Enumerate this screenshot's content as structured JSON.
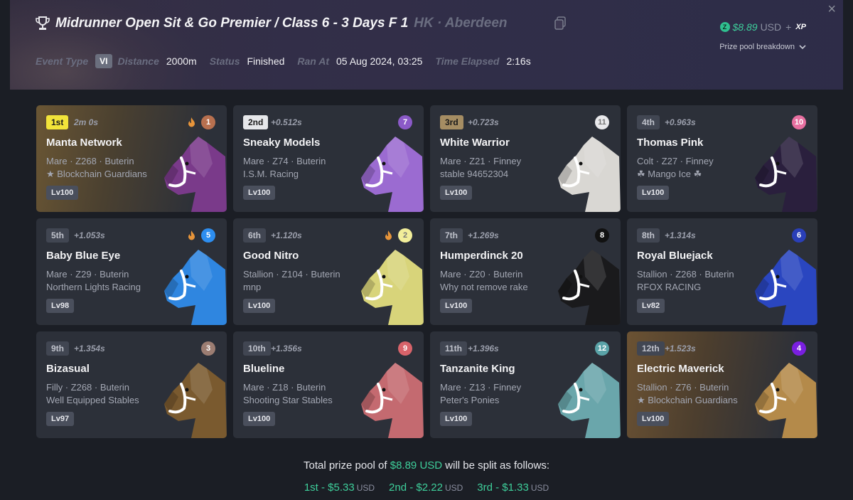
{
  "header": {
    "title": "Midrunner Open Sit & Go Premier / Class 6 - 3 Days F 1",
    "location": "HK · Aberdeen",
    "event_type_label": "Event Type",
    "event_type_badge": "VI",
    "distance_label": "Distance",
    "distance_value": "2000m",
    "status_label": "Status",
    "status_value": "Finished",
    "ran_at_label": "Ran At",
    "ran_at_value": "05 Aug 2024, 03:25",
    "elapsed_label": "Time Elapsed",
    "elapsed_value": "2:16s",
    "prize_amount": "$8.89",
    "prize_currency": "USD",
    "prize_plus": "+",
    "prize_xp": "XP",
    "breakdown_label": "Prize pool breakdown",
    "close_glyph": "×",
    "z_glyph": "Z"
  },
  "horses": [
    {
      "place": "1st",
      "gap": "2m 0s",
      "gate": "1",
      "gate_color": "#b8704f",
      "flame": true,
      "name": "Manta Network",
      "line1": "Mare · Z268 · Buterin",
      "line2": "★ Blockchain Guardians",
      "level": "Lv100",
      "coat": "#7a3a8a",
      "card": "gold"
    },
    {
      "place": "2nd",
      "gap": "+0.512s",
      "gate": "7",
      "gate_color": "#8b5ac8",
      "flame": false,
      "name": "Sneaky Models",
      "line1": "Mare · Z74 · Buterin",
      "line2": "I.S.M. Racing",
      "level": "Lv100",
      "coat": "#9b6bd1",
      "card": ""
    },
    {
      "place": "3rd",
      "gap": "+0.723s",
      "gate": "11",
      "gate_color": "#e9e9ec",
      "flame": false,
      "name": "White Warrior",
      "line1": "Mare · Z21 · Finney",
      "line2": "stable 94652304",
      "level": "Lv100",
      "coat": "#d9d7d3",
      "card": ""
    },
    {
      "place": "4th",
      "gap": "+0.963s",
      "gate": "10",
      "gate_color": "#e76fa0",
      "flame": false,
      "name": "Thomas Pink",
      "line1": "Colt · Z27 · Finney",
      "line2": "☘ Mango Ice ☘",
      "level": "Lv100",
      "coat": "#2a1f3d",
      "card": ""
    },
    {
      "place": "5th",
      "gap": "+1.053s",
      "gate": "5",
      "gate_color": "#2d8ef0",
      "flame": true,
      "name": "Baby Blue Eye",
      "line1": "Mare · Z29 · Buterin",
      "line2": "Northern Lights Racing",
      "level": "Lv98",
      "coat": "#2f86e0",
      "card": ""
    },
    {
      "place": "6th",
      "gap": "+1.120s",
      "gate": "2",
      "gate_color": "#f2ee9a",
      "flame": true,
      "name": "Good Nitro",
      "line1": "Stallion · Z104 · Buterin",
      "line2": "mnp",
      "level": "Lv100",
      "coat": "#d8d47a",
      "card": ""
    },
    {
      "place": "7th",
      "gap": "+1.269s",
      "gate": "8",
      "gate_color": "#111111",
      "flame": false,
      "name": "Humperdinck 20",
      "line1": "Mare · Z20 · Buterin",
      "line2": "Why not remove rake",
      "level": "Lv100",
      "coat": "#1a1a1c",
      "card": ""
    },
    {
      "place": "8th",
      "gap": "+1.314s",
      "gate": "6",
      "gate_color": "#2a3fb8",
      "flame": false,
      "name": "Royal Bluejack",
      "line1": "Stallion · Z268 · Buterin",
      "line2": "RFOX RACING",
      "level": "Lv82",
      "coat": "#2a46c0",
      "card": ""
    },
    {
      "place": "9th",
      "gap": "+1.354s",
      "gate": "3",
      "gate_color": "#9c7d72",
      "flame": false,
      "name": "Bizasual",
      "line1": "Filly · Z268 · Buterin",
      "line2": "Well Equipped Stables",
      "level": "Lv97",
      "coat": "#7a5a2f",
      "card": ""
    },
    {
      "place": "10th",
      "gap": "+1.356s",
      "gate": "9",
      "gate_color": "#d8636a",
      "flame": false,
      "name": "Blueline",
      "line1": "Mare · Z18 · Buterin",
      "line2": "Shooting Star Stables",
      "level": "Lv100",
      "coat": "#c46a70",
      "card": ""
    },
    {
      "place": "11th",
      "gap": "+1.396s",
      "gate": "12",
      "gate_color": "#5aa3a8",
      "flame": false,
      "name": "Tanzanite King",
      "line1": "Mare · Z13 · Finney",
      "line2": "Peter's Ponies",
      "level": "Lv100",
      "coat": "#6aa6ab",
      "card": ""
    },
    {
      "place": "12th",
      "gap": "+1.523s",
      "gate": "4",
      "gate_color": "#7a1fe0",
      "flame": false,
      "name": "Electric Maverick",
      "line1": "Stallion · Z76 · Buterin",
      "line2": "★ Blockchain Guardians",
      "level": "Lv100",
      "coat": "#b48a4a",
      "card": "brown"
    }
  ],
  "footer": {
    "pre": "Total prize pool of",
    "amount": "$8.89 USD",
    "post": "will be split as follows:",
    "splits": [
      {
        "label": "1st - $5.33",
        "currency": "USD"
      },
      {
        "label": "2nd - $2.22",
        "currency": "USD"
      },
      {
        "label": "3rd - $1.33",
        "currency": "USD"
      }
    ]
  },
  "colors": {
    "accent_green": "#3ecf9b",
    "first_place": "#f2e43a"
  }
}
